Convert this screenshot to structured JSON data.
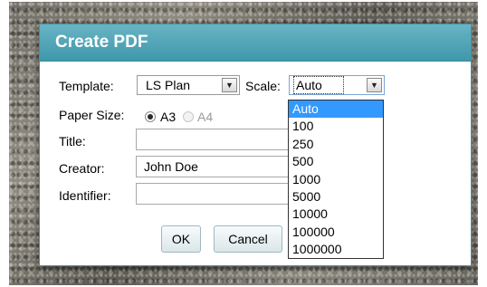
{
  "dialog": {
    "title": "Create PDF"
  },
  "form": {
    "template_label": "Template:",
    "template_value": "LS Plan",
    "scale_label": "Scale:",
    "scale_value": "Auto",
    "paper_size_label": "Paper Size:",
    "paper_a3": "A3",
    "paper_a4": "A4",
    "title_label": "Title:",
    "title_value": "",
    "creator_label": "Creator:",
    "creator_value": "John Doe",
    "identifier_label": "Identifier:",
    "identifier_value": ""
  },
  "buttons": {
    "ok": "OK",
    "cancel": "Cancel"
  },
  "scale_options": [
    "Auto",
    "100",
    "250",
    "500",
    "1000",
    "5000",
    "10000",
    "100000",
    "1000000"
  ],
  "colors": {
    "title_bar": "#3f98ab",
    "selected_option": "#3399ff"
  }
}
